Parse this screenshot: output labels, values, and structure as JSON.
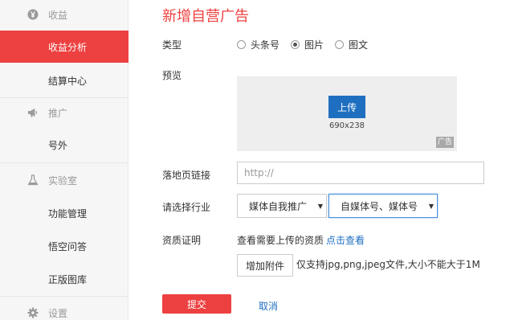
{
  "sidebar": {
    "sections": [
      {
        "label": "收益",
        "icon": "yen-coin-icon"
      },
      {
        "label": "推广",
        "icon": "megaphone-icon"
      },
      {
        "label": "实验室",
        "icon": "flask-icon"
      },
      {
        "label": "设置",
        "icon": "gear-icon"
      }
    ],
    "items": [
      {
        "label": "收益分析"
      },
      {
        "label": "结算中心"
      },
      {
        "label": "号外"
      },
      {
        "label": "功能管理"
      },
      {
        "label": "悟空问答"
      },
      {
        "label": "正版图库"
      }
    ],
    "active": "收益分析"
  },
  "page": {
    "title": "新增自营广告"
  },
  "form": {
    "type": {
      "label": "类型",
      "options": [
        "头条号",
        "图片",
        "图文"
      ],
      "selected": "图片"
    },
    "preview": {
      "label": "预览",
      "upload_label": "上传",
      "size": "690x238",
      "ad_tag": "广告"
    },
    "landing": {
      "label": "落地页链接",
      "placeholder": "http://",
      "value": ""
    },
    "industry": {
      "label": "请选择行业",
      "primary": "媒体自我推广",
      "secondary": "自媒体号、媒体号",
      "arrow": "▼"
    },
    "qualification": {
      "label": "资质证明",
      "text": "查看需要上传的资质",
      "link": "点击查看",
      "attach_label": "增加附件",
      "hint": "仅支持jpg,png,jpeg文件,大小不能大于1M"
    },
    "submit_label": "提交",
    "cancel_label": "取消"
  },
  "colors": {
    "accent": "#ed4040",
    "link": "#1f6fc0",
    "upload": "#1f6fc0"
  }
}
